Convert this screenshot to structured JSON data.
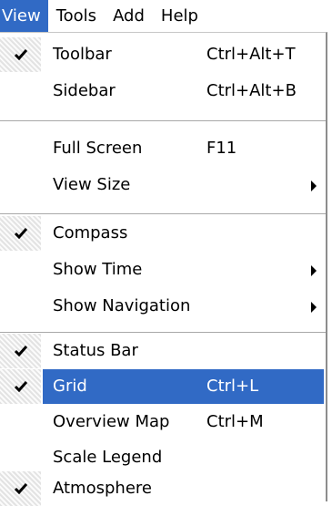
{
  "menubar": {
    "items": [
      {
        "label": "View"
      },
      {
        "label": "Tools"
      },
      {
        "label": "Add"
      },
      {
        "label": "Help"
      }
    ]
  },
  "menu": {
    "items": [
      {
        "label": "Toolbar",
        "shortcut": "Ctrl+Alt+T",
        "checked": true
      },
      {
        "label": "Sidebar",
        "shortcut": "Ctrl+Alt+B",
        "checked": false
      },
      {
        "label": "Full Screen",
        "shortcut": "F11",
        "checked": false
      },
      {
        "label": "View Size",
        "shortcut": "",
        "checked": false,
        "submenu": true
      },
      {
        "label": "Compass",
        "shortcut": "",
        "checked": true
      },
      {
        "label": "Show Time",
        "shortcut": "",
        "checked": false,
        "submenu": true
      },
      {
        "label": "Show Navigation",
        "shortcut": "",
        "checked": false,
        "submenu": true
      },
      {
        "label": "Status Bar",
        "shortcut": "",
        "checked": true
      },
      {
        "label": "Grid",
        "shortcut": "Ctrl+L",
        "checked": true,
        "highlighted": true
      },
      {
        "label": "Overview Map",
        "shortcut": "Ctrl+M",
        "checked": false
      },
      {
        "label": "Scale Legend",
        "shortcut": "",
        "checked": false
      },
      {
        "label": "Atmosphere",
        "shortcut": "",
        "checked": true
      }
    ]
  },
  "colors": {
    "highlight": "#316ac5",
    "highlight_text": "#ffffff"
  }
}
